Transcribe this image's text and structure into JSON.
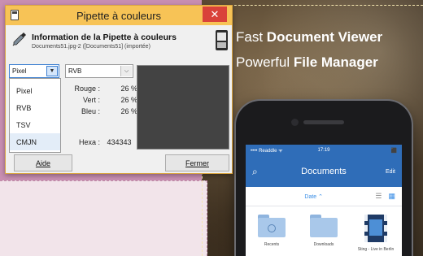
{
  "dialog": {
    "title": "Pipette à couleurs",
    "close_glyph": "✕",
    "header_title": "Information de la Pipette à couleurs",
    "header_subtitle": "Documents51.jpg-2 ([Documents51] (importée)",
    "mode_left": {
      "value": "Pixel",
      "options": [
        "Pixel",
        "RVB",
        "TSV",
        "CMJN"
      ],
      "selected_option": "CMJN"
    },
    "mode_right": {
      "value": "RVB"
    },
    "values": [
      {
        "label": "Rouge :",
        "value": "26 %"
      },
      {
        "label": "Vert :",
        "value": "26 %"
      },
      {
        "label": "Bleu :",
        "value": "26 %"
      }
    ],
    "hex": {
      "label": "Hexa :",
      "value": "434343"
    },
    "swatch_color": "#434343",
    "help_button": "Aide",
    "close_button": "Fermer"
  },
  "promo": {
    "line1_regular": "Fast ",
    "line1_bold": "Document Viewer",
    "line2_regular": "Powerful ",
    "line2_bold": "File Manager"
  },
  "phone": {
    "status_carrier": "•••• Readdle ᯤ",
    "status_time": "17:19",
    "status_battery": "⬛",
    "nav_title": "Documents",
    "nav_edit": "Edit",
    "sort_label": "Date ⌃",
    "folders": [
      {
        "label": "Recents"
      },
      {
        "label": "Downloads"
      },
      {
        "label": "Sting - Live in Berlin"
      }
    ]
  },
  "colors": {
    "title_bar": "#f7c356",
    "close_button": "#d9423a",
    "phone_header": "#2f6db8",
    "canvas_pink": "#c98fb2"
  }
}
